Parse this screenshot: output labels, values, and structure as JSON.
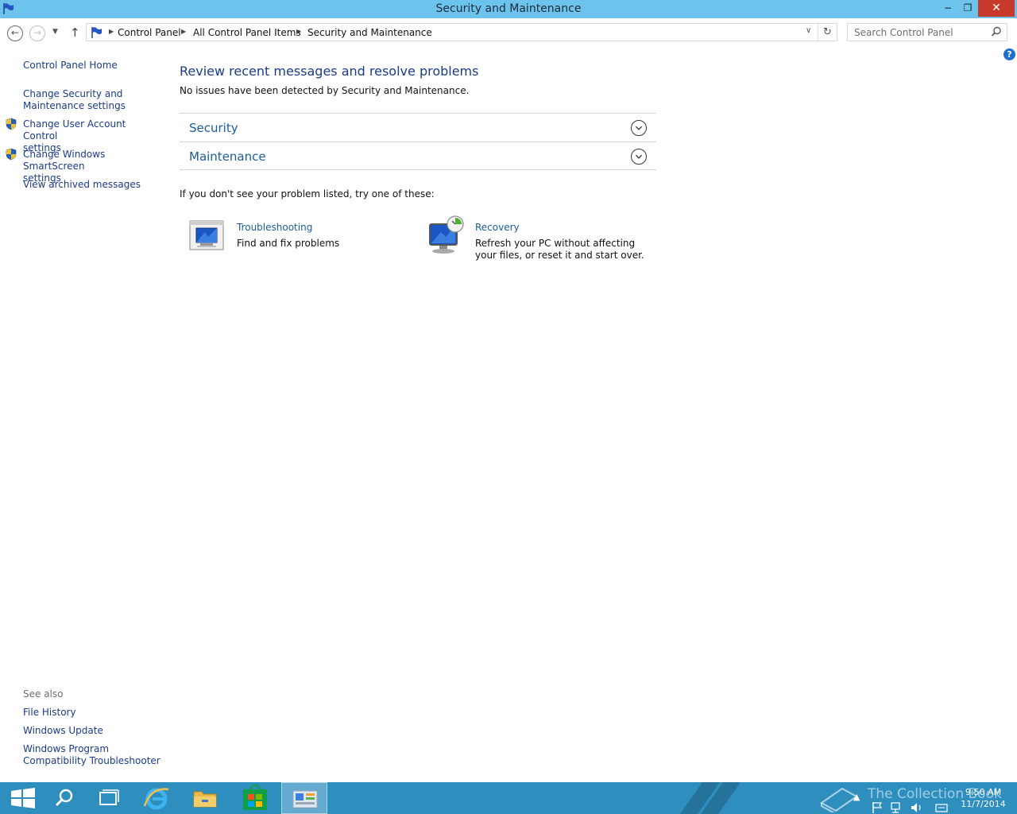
{
  "window": {
    "title": "Security and Maintenance",
    "minimize": "−",
    "restore": "❐",
    "close": "✕"
  },
  "nav": {
    "back": "←",
    "forward": "→",
    "recent": "▼",
    "up": "↑",
    "breadcrumbs": [
      "Control Panel",
      "All Control Panel Items",
      "Security and Maintenance"
    ],
    "separator": "▶",
    "dropdown": "∨",
    "refresh": "↻",
    "search_placeholder": "Search Control Panel"
  },
  "help": "?",
  "sidebar": {
    "home": "Control Panel Home",
    "items": [
      {
        "line1": "Change Security and",
        "line2": "Maintenance settings",
        "shield": false
      },
      {
        "line1": "Change User Account Control",
        "line2": "settings",
        "shield": true
      },
      {
        "line1": "Change Windows SmartScreen",
        "line2": "settings",
        "shield": true
      },
      {
        "line1": "View archived messages",
        "line2": "",
        "shield": false
      }
    ],
    "see_also_label": "See also",
    "see_also": [
      {
        "line1": "File History",
        "line2": ""
      },
      {
        "line1": "Windows Update",
        "line2": ""
      },
      {
        "line1": "Windows Program",
        "line2": "Compatibility Troubleshooter"
      }
    ]
  },
  "main": {
    "title": "Review recent messages and resolve problems",
    "subtitle": "No issues have been detected by Security and Maintenance.",
    "sections": [
      "Security",
      "Maintenance"
    ],
    "hint": "If you don't see your problem listed, try one of these:",
    "tools": [
      {
        "title": "Troubleshooting",
        "desc1": "Find and fix problems",
        "desc2": ""
      },
      {
        "title": "Recovery",
        "desc1": "Refresh your PC without affecting",
        "desc2": "your files, or reset it and start over."
      }
    ]
  },
  "taskbar": {
    "time": "9:50 AM",
    "date": "11/7/2014",
    "watermark": "The Collection Book"
  },
  "colors": {
    "titlebar": "#6cc4ec",
    "link": "#1a3b8a",
    "taskbar": "#2e8fbf",
    "close": "#c7392b"
  }
}
